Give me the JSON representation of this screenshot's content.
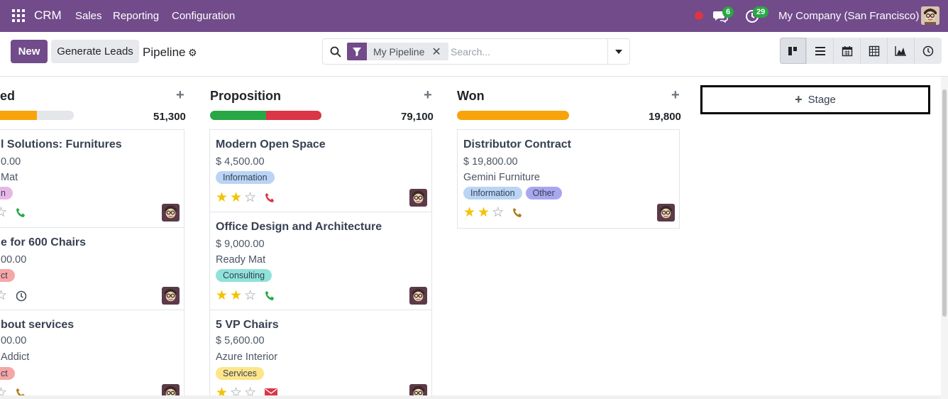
{
  "navbar": {
    "brand": "CRM",
    "menu": [
      "Sales",
      "Reporting",
      "Configuration"
    ],
    "chat_count": "6",
    "activity_count": "29",
    "company": "My Company (San Francisco)"
  },
  "control_panel": {
    "new_label": "New",
    "generate_label": "Generate Leads",
    "title": "Pipeline",
    "facet_label": "My Pipeline",
    "search_placeholder": "Search...",
    "views": [
      "kanban-icon",
      "list-icon",
      "calendar-icon",
      "pivot-icon",
      "graph-icon",
      "activity-icon"
    ]
  },
  "columns": [
    {
      "title": "ed",
      "total": "51,300",
      "cards": [
        {
          "title": "l Solutions: Furnitures",
          "amount": "0.00",
          "company": "Mat",
          "tags": [
            {
              "label": "n",
              "color": "#e7b8e6"
            }
          ],
          "stars": 1,
          "activity": "phone",
          "activity_color": "#28a745"
        },
        {
          "title": "e for 600 Chairs",
          "amount": "00.00",
          "company": "",
          "tags": [
            {
              "label": "ct",
              "color": "#f6a6a6"
            }
          ],
          "stars": 1,
          "activity": "clock",
          "activity_color": "#495057"
        },
        {
          "title": "bout services",
          "amount": "00.00",
          "company": "Addict",
          "tags": [
            {
              "label": "ct",
              "color": "#f6a6a6"
            }
          ],
          "stars": 1,
          "activity": "phone",
          "activity_color": "#b07d1a"
        }
      ]
    },
    {
      "title": "Proposition",
      "total": "79,100",
      "cards": [
        {
          "title": "Modern Open Space",
          "amount": "$ 4,500.00",
          "company": "",
          "tags": [
            {
              "label": "Information",
              "color": "#b9d4f5"
            }
          ],
          "stars": 2,
          "activity": "phone",
          "activity_color": "#dc3545"
        },
        {
          "title": "Office Design and Architecture",
          "amount": "$ 9,000.00",
          "company": "Ready Mat",
          "tags": [
            {
              "label": "Consulting",
              "color": "#8fe2d9"
            }
          ],
          "stars": 2,
          "activity": "phone",
          "activity_color": "#28a745"
        },
        {
          "title": "5 VP Chairs",
          "amount": "$ 5,600.00",
          "company": "Azure Interior",
          "tags": [
            {
              "label": "Services",
              "color": "#fde58a"
            }
          ],
          "stars": 1,
          "activity": "mail",
          "activity_color": "#dc3545"
        }
      ]
    },
    {
      "title": "Won",
      "total": "19,800",
      "cards": [
        {
          "title": "Distributor Contract",
          "amount": "$ 19,800.00",
          "company": "Gemini Furniture",
          "tags": [
            {
              "label": "Information",
              "color": "#b9d4f5"
            },
            {
              "label": "Other",
              "color": "#a9a6f0"
            }
          ],
          "stars": 2,
          "activity": "phone",
          "activity_color": "#b07d1a"
        }
      ]
    }
  ],
  "add_stage_label": "Stage"
}
